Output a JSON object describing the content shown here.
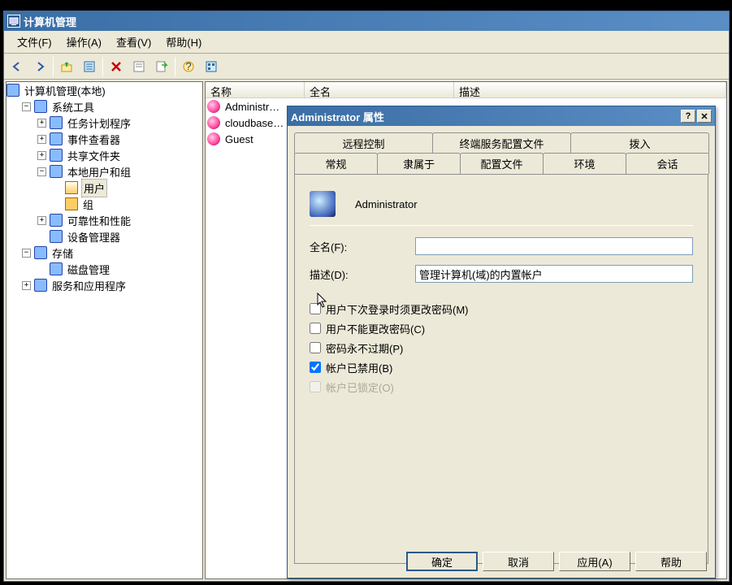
{
  "window": {
    "title": "计算机管理"
  },
  "menus": {
    "file": "文件(F)",
    "action": "操作(A)",
    "view": "查看(V)",
    "help": "帮助(H)"
  },
  "tree": {
    "root": "计算机管理(本地)",
    "sys_tools": "系统工具",
    "task_scheduler": "任务计划程序",
    "event_viewer": "事件查看器",
    "shared_folders": "共享文件夹",
    "local_users_groups": "本地用户和组",
    "users": "用户",
    "groups": "组",
    "reliability": "可靠性和性能",
    "device_manager": "设备管理器",
    "storage": "存储",
    "disk_management": "磁盘管理",
    "services_apps": "服务和应用程序"
  },
  "list": {
    "columns": {
      "name": "名称",
      "fullname": "全名",
      "description": "描述"
    },
    "rows": [
      {
        "name": "Administr…"
      },
      {
        "name": "cloudbase…"
      },
      {
        "name": "Guest"
      }
    ]
  },
  "dialog": {
    "title": "Administrator 属性",
    "tabs": {
      "remote_control": "远程控制",
      "ts_profile": "终端服务配置文件",
      "dialin": "拨入",
      "general": "常规",
      "member_of": "隶属于",
      "profile": "配置文件",
      "environment": "环境",
      "sessions": "会话"
    },
    "user_name": "Administrator",
    "labels": {
      "fullname": "全名(F):",
      "description": "描述(D):"
    },
    "values": {
      "fullname": "",
      "description": "管理计算机(域)的内置帐户"
    },
    "checks": {
      "must_change": "用户下次登录时须更改密码(M)",
      "cannot_change": "用户不能更改密码(C)",
      "never_expires": "密码永不过期(P)",
      "disabled": "帐户已禁用(B)",
      "locked": "帐户已锁定(O)"
    },
    "buttons": {
      "ok": "确定",
      "cancel": "取消",
      "apply": "应用(A)",
      "help": "帮助"
    }
  }
}
